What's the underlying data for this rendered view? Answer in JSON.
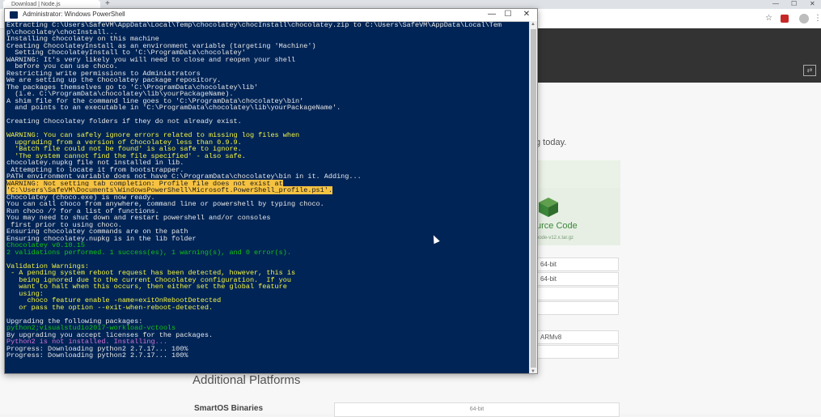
{
  "browser": {
    "tab_title": "Download | Node.js",
    "new_tab_glyph": "+",
    "toolbar_icons": [
      "star-icon",
      "extension-icon",
      "avatar",
      "menu-icon"
    ],
    "min_glyph": "—",
    "max_glyph": "☐",
    "close_glyph": "✕",
    "star_glyph": "☆",
    "menu_glyph": "⋮"
  },
  "page": {
    "today_text": "g today.",
    "source_code_label": "urce Code",
    "source_sub": "node-v12.x.tar.gz",
    "bit_cells": [
      "64-bit",
      "64-bit",
      "",
      "",
      "ARMv8",
      ""
    ],
    "additional_platforms": "Additional Platforms",
    "smartos_label": "SmartOS Binaries",
    "smartos_value": "64-bit",
    "header_color": "#333333",
    "accent_green": "#3c873a"
  },
  "powershell": {
    "title": "Administrator: Windows PowerShell",
    "bg_color": "#012456",
    "min_glyph": "—",
    "max_glyph": "☐",
    "close_glyph": "✕",
    "lines": [
      {
        "c": "c-white",
        "t": "Extracting C:\\Users\\SafeVM\\AppData\\Local\\Temp\\chocolatey\\chocInstall\\chocolatey.zip to C:\\Users\\SafeVM\\AppData\\Local\\Tem"
      },
      {
        "c": "c-white",
        "t": "p\\chocolatey\\chocInstall..."
      },
      {
        "c": "c-white",
        "t": "Installing chocolatey on this machine"
      },
      {
        "c": "c-white",
        "t": "Creating ChocolateyInstall as an environment variable (targeting 'Machine')"
      },
      {
        "c": "c-white",
        "t": "  Setting ChocolateyInstall to 'C:\\ProgramData\\chocolatey'"
      },
      {
        "c": "c-white",
        "t": "WARNING: It's very likely you will need to close and reopen your shell"
      },
      {
        "c": "c-white",
        "t": "  before you can use choco."
      },
      {
        "c": "c-white",
        "t": "Restricting write permissions to Administrators"
      },
      {
        "c": "c-white",
        "t": "We are setting up the Chocolatey package repository."
      },
      {
        "c": "c-white",
        "t": "The packages themselves go to 'C:\\ProgramData\\chocolatey\\lib'"
      },
      {
        "c": "c-white",
        "t": "  (i.e. C:\\ProgramData\\chocolatey\\lib\\yourPackageName)."
      },
      {
        "c": "c-white",
        "t": "A shim file for the command line goes to 'C:\\ProgramData\\chocolatey\\bin'"
      },
      {
        "c": "c-white",
        "t": "  and points to an executable in 'C:\\ProgramData\\chocolatey\\lib\\yourPackageName'."
      },
      {
        "c": "c-white",
        "t": ""
      },
      {
        "c": "c-white",
        "t": "Creating Chocolatey folders if they do not already exist."
      },
      {
        "c": "c-white",
        "t": ""
      },
      {
        "c": "c-yellow",
        "t": "WARNING: You can safely ignore errors related to missing log files when"
      },
      {
        "c": "c-yellow",
        "t": "  upgrading from a version of Chocolatey less than 0.9.9."
      },
      {
        "c": "c-yellow",
        "t": "  'Batch file could not be found' is also safe to ignore."
      },
      {
        "c": "c-yellow",
        "t": "  'The system cannot find the file specified' - also safe."
      },
      {
        "c": "c-white",
        "t": "chocolatey.nupkg file not installed in lib."
      },
      {
        "c": "c-white",
        "t": " Attempting to locate it from bootstrapper."
      },
      {
        "c": "c-white",
        "t": "PATH environment variable does not have C:\\ProgramData\\chocolatey\\bin in it. Adding..."
      },
      {
        "c": "c-warnbg",
        "t": "WARNING: Not setting tab completion: Profile file does not exist at"
      },
      {
        "c": "c-warnbg",
        "t": "'C:\\Users\\SafeVM\\Documents\\WindowsPowerShell\\Microsoft.PowerShell_profile.ps1'."
      },
      {
        "c": "c-white",
        "t": "Chocolatey (choco.exe) is now ready."
      },
      {
        "c": "c-white",
        "t": "You can call choco from anywhere, command line or powershell by typing choco."
      },
      {
        "c": "c-white",
        "t": "Run choco /? for a list of functions."
      },
      {
        "c": "c-white",
        "t": "You may need to shut down and restart powershell and/or consoles"
      },
      {
        "c": "c-white",
        "t": " first prior to using choco."
      },
      {
        "c": "c-white",
        "t": "Ensuring chocolatey commands are on the path"
      },
      {
        "c": "c-white",
        "t": "Ensuring chocolatey.nupkg is in the lib folder"
      },
      {
        "c": "c-green",
        "t": "Chocolatey v0.10.15"
      },
      {
        "c": "c-green",
        "t": "2 validations performed. 1 success(es), 1 warning(s), and 0 error(s)."
      },
      {
        "c": "c-white",
        "t": ""
      },
      {
        "c": "c-yellow",
        "t": "Validation Warnings:"
      },
      {
        "c": "c-yellow",
        "t": " - A pending system reboot request has been detected, however, this is"
      },
      {
        "c": "c-yellow",
        "t": "   being ignored due to the current Chocolatey configuration.  If you"
      },
      {
        "c": "c-yellow",
        "t": "   want to halt when this occurs, then either set the global feature"
      },
      {
        "c": "c-yellow",
        "t": "   using:"
      },
      {
        "c": "c-yellow",
        "t": "     choco feature enable -name=exitOnRebootDetected"
      },
      {
        "c": "c-yellow",
        "t": "   or pass the option --exit-when-reboot-detected."
      },
      {
        "c": "c-white",
        "t": ""
      },
      {
        "c": "c-white",
        "t": "Upgrading the following packages:"
      },
      {
        "c": "c-green",
        "t": "python2;visualstudio2017-workload-vctools"
      },
      {
        "c": "c-white",
        "t": "By upgrading you accept licenses for the packages."
      },
      {
        "c": "c-magenta",
        "t": "Python2 is not installed. Installing..."
      },
      {
        "c": "c-white",
        "t": "Progress: Downloading python2 2.7.17... 100%"
      },
      {
        "c": "c-white",
        "t": "Progress: Downloading python2 2.7.17... 100%"
      }
    ]
  }
}
